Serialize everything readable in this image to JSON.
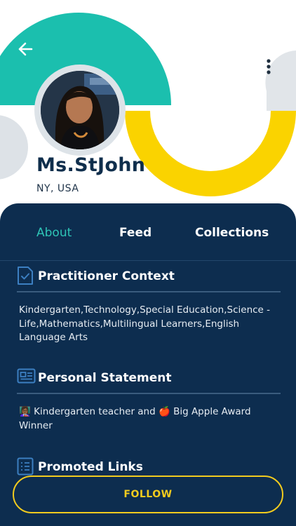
{
  "profile": {
    "name": "Ms.StJohn",
    "location": "NY, USA"
  },
  "tabs": [
    {
      "label": "About",
      "active": true
    },
    {
      "label": "Feed",
      "active": false
    },
    {
      "label": "Collections",
      "active": false
    }
  ],
  "sections": {
    "practitioner": {
      "title": "Practitioner Context",
      "text": "Kindergarten,Technology,Special Education,Science - Life,Mathematics,Multilingual Learners,English Language Arts"
    },
    "statement": {
      "title": "Personal Statement",
      "text": "👩🏾‍🏫 Kindergarten teacher and 🍎 Big Apple Award Winner"
    },
    "links": {
      "title": "Promoted Links"
    }
  },
  "actions": {
    "follow_label": "FOLLOW"
  },
  "colors": {
    "teal": "#1bbfae",
    "yellow": "#fad300",
    "navy": "#0d2d4f",
    "accent_tab": "#2ec4b6",
    "follow": "#f2cb1e"
  },
  "icons": {
    "back": "arrow-left-icon",
    "more": "more-vertical-icon",
    "practitioner": "document-check-icon",
    "statement": "id-card-icon",
    "links": "list-icon"
  }
}
